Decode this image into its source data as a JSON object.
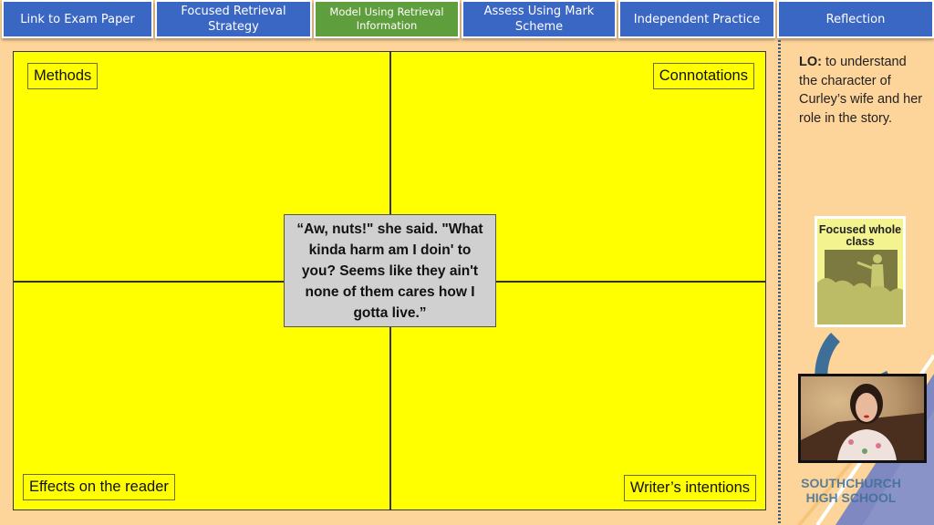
{
  "nav": {
    "items": [
      {
        "label": "Link to Exam Paper",
        "active": false
      },
      {
        "label": "Focused Retrieval Strategy",
        "active": false
      },
      {
        "label": "Model Using Retrieval Information",
        "active": true
      },
      {
        "label": "Assess Using Mark Scheme",
        "active": false
      },
      {
        "label": "Independent Practice",
        "active": false
      },
      {
        "label": "Reflection",
        "active": false
      }
    ]
  },
  "board": {
    "labels": {
      "top_left": "Methods",
      "top_right": "Connotations",
      "bottom_left": "Effects on the reader",
      "bottom_right": "Writer’s intentions"
    },
    "quote": "“Aw, nuts!\" she said. \"What kinda harm am I doin' to you? Seems like they ain't none of them cares how I gotta live.”"
  },
  "sidebar": {
    "lo_prefix": "LO:",
    "lo_text": " to understand the character of Curley’s wife and her role in the story.",
    "card_title": "Focused whole class",
    "school_line1": "SOUTHCHURCH",
    "school_line2": "HIGH SCHOOL"
  },
  "colors": {
    "background": "#fdd49a",
    "nav_blue": "#3a66c4",
    "nav_green": "#5f9e3c",
    "board_yellow": "#ffff00",
    "quote_grey": "#d0d0d0",
    "school_blue": "#3e6f98",
    "deco_purple": "#7f88c0"
  }
}
